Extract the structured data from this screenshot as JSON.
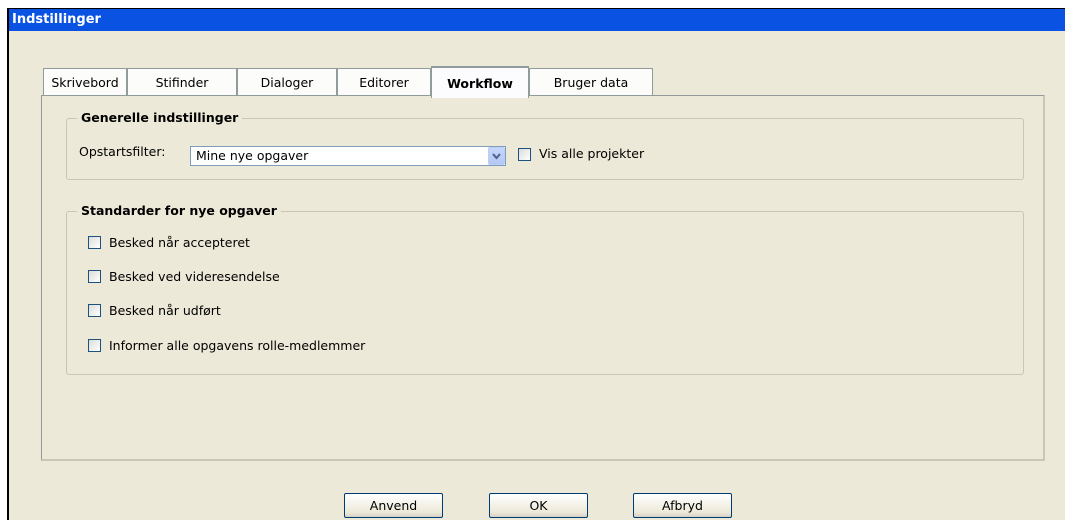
{
  "window": {
    "title": "Indstillinger"
  },
  "tabs": [
    {
      "label": "Skrivebord"
    },
    {
      "label": "Stifinder"
    },
    {
      "label": "Dialoger"
    },
    {
      "label": "Editorer"
    },
    {
      "label": "Workflow",
      "selected": true
    },
    {
      "label": "Bruger data"
    }
  ],
  "general": {
    "legend": "Generelle indstillinger",
    "startup_filter_label": "Opstartsfilter:",
    "startup_filter_value": "Mine nye opgaver",
    "show_all_projects_label": "Vis alle projekter",
    "show_all_projects_checked": false
  },
  "defaults": {
    "legend": "Standarder for nye opgaver",
    "options": [
      {
        "label": "Besked når accepteret",
        "checked": false
      },
      {
        "label": "Besked ved videresendelse",
        "checked": false
      },
      {
        "label": "Besked når udført",
        "checked": false
      },
      {
        "label": "Informer alle opgavens rolle-medlemmer",
        "checked": false
      }
    ]
  },
  "buttons": {
    "apply": "Anvend",
    "ok": "OK",
    "cancel": "Afbryd"
  },
  "colors": {
    "titlebar": "#0a53e2",
    "dialog_bg": "#ece9d8",
    "accent_checkbox_border": "#1c5180"
  }
}
